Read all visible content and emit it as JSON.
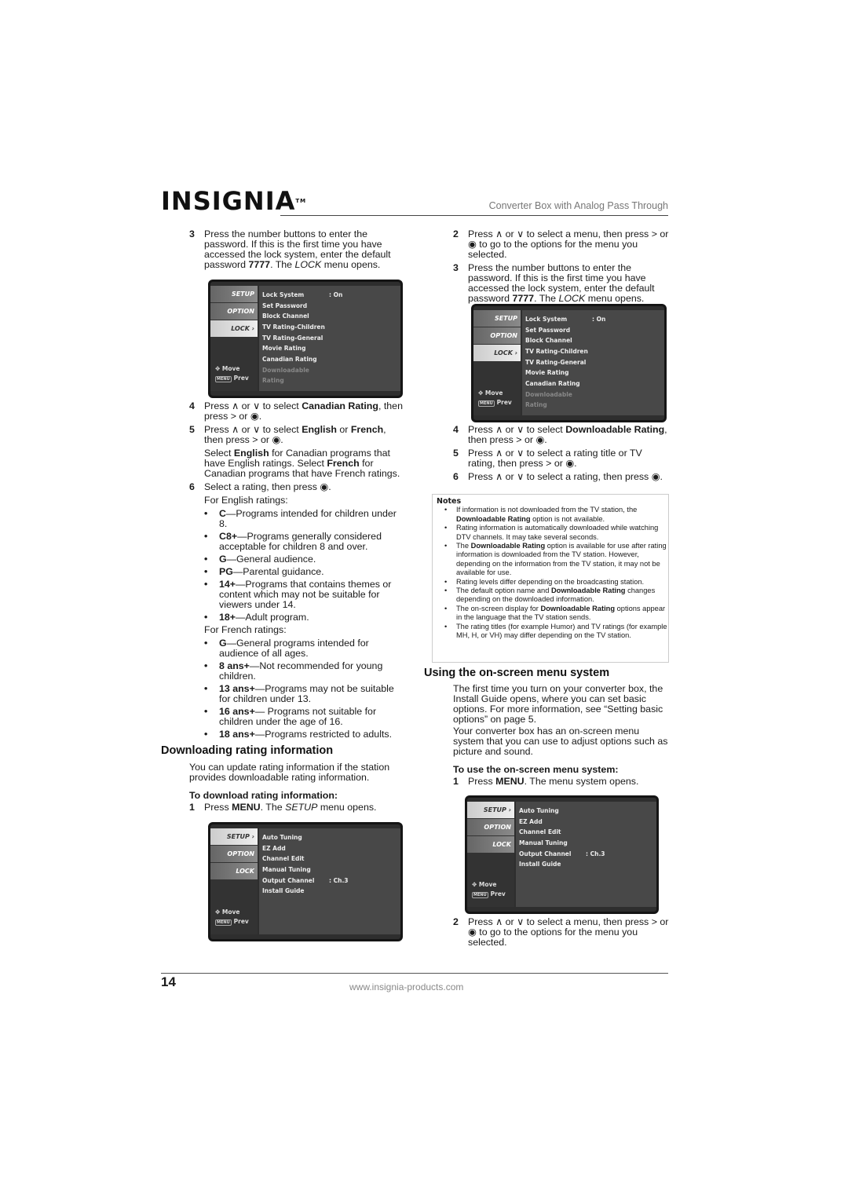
{
  "header": {
    "logo": "INSIGNIA",
    "tm": "TM",
    "title": "Converter Box with Analog Pass Through"
  },
  "left": {
    "step3": {
      "n": "3",
      "text": [
        [
          "Press the number buttons to enter the password. If this is the first time you have accessed the lock system, enter the default password ",
          ""
        ],
        [
          "7777",
          "b"
        ],
        [
          ". The ",
          ""
        ],
        [
          "LOCK",
          "i"
        ],
        [
          " menu opens.",
          ""
        ]
      ]
    },
    "step4": {
      "n": "4",
      "text": [
        [
          "Press ∧ or ∨ to select ",
          ""
        ],
        [
          "Canadian Rating",
          "b"
        ],
        [
          ", then press > or ◉.",
          ""
        ]
      ]
    },
    "step5": {
      "n": "5",
      "text": [
        [
          "Press ∧ or ∨ to select ",
          ""
        ],
        [
          "English",
          "b"
        ],
        [
          " or ",
          ""
        ],
        [
          "French",
          "b"
        ],
        [
          ", then press > or ◉.",
          ""
        ]
      ]
    },
    "step5_para": [
      [
        "Select ",
        ""
      ],
      [
        "English",
        "b"
      ],
      [
        " for Canadian programs that have English ratings. Select ",
        ""
      ],
      [
        "French",
        "b"
      ],
      [
        " for Canadian programs that have French ratings.",
        ""
      ]
    ],
    "step6": {
      "n": "6",
      "text": [
        [
          "Select a rating, then press ◉.",
          ""
        ]
      ]
    },
    "english_label": "For English ratings:",
    "english": [
      [
        [
          "C",
          "b"
        ],
        [
          "—Programs intended for children under 8.",
          ""
        ]
      ],
      [
        [
          "C8+",
          "b"
        ],
        [
          "—Programs generally considered acceptable for children 8 and over.",
          ""
        ]
      ],
      [
        [
          "G",
          "b"
        ],
        [
          "—General audience.",
          ""
        ]
      ],
      [
        [
          "PG",
          "b"
        ],
        [
          "—Parental guidance.",
          ""
        ]
      ],
      [
        [
          "14+",
          "b"
        ],
        [
          "—Programs that contains themes or content which may not be suitable for viewers under 14.",
          ""
        ]
      ],
      [
        [
          "18+",
          "b"
        ],
        [
          "—Adult program.",
          ""
        ]
      ]
    ],
    "french_label": "For French ratings:",
    "french": [
      [
        [
          "G",
          "b"
        ],
        [
          "—General programs intended for audience of all ages.",
          ""
        ]
      ],
      [
        [
          "8 ans+",
          "b"
        ],
        [
          "—Not recommended for young children.",
          ""
        ]
      ],
      [
        [
          "13 ans+",
          "b"
        ],
        [
          "—Programs may not be suitable for children under 13.",
          ""
        ]
      ],
      [
        [
          "16 ans+",
          "b"
        ],
        [
          "— Programs not suitable for children under the age of 16.",
          ""
        ]
      ],
      [
        [
          "18 ans+",
          "b"
        ],
        [
          "—Programs restricted to adults.",
          ""
        ]
      ]
    ],
    "heading": "Downloading rating information",
    "intro": "You can update rating information if the station provides downloadable rating information.",
    "subhead": "To download rating information:",
    "step1": {
      "n": "1",
      "text": [
        [
          "Press ",
          ""
        ],
        [
          "MENU",
          "b"
        ],
        [
          ". The ",
          ""
        ],
        [
          "SETUP",
          "i"
        ],
        [
          " menu opens.",
          ""
        ]
      ]
    }
  },
  "right": {
    "step2": {
      "n": "2",
      "text": [
        [
          "Press ∧ or ∨ to select a menu, then press > or ◉ to go to the options for the menu you selected.",
          ""
        ]
      ]
    },
    "step3": {
      "n": "3",
      "text": [
        [
          "Press the number buttons to enter the password. If this is the first time you have accessed the lock system, enter the default password ",
          ""
        ],
        [
          "7777",
          "b"
        ],
        [
          ". The ",
          ""
        ],
        [
          "LOCK",
          "i"
        ],
        [
          " menu opens.",
          ""
        ]
      ]
    },
    "step4": {
      "n": "4",
      "text": [
        [
          "Press ∧ or ∨ to select ",
          ""
        ],
        [
          "Downloadable Rating",
          "b"
        ],
        [
          ", then press > or ◉.",
          ""
        ]
      ]
    },
    "step5": {
      "n": "5",
      "text": [
        [
          "Press ∧ or ∨ to select a rating title or TV rating, then press > or ◉.",
          ""
        ]
      ]
    },
    "step6": {
      "n": "6",
      "text": [
        [
          "Press ∧ or ∨ to select a rating, then press ◉.",
          ""
        ]
      ]
    },
    "notes": {
      "title": "Notes",
      "items": [
        [
          [
            "If information is not downloaded from the TV station, the ",
            ""
          ],
          [
            "Downloadable Rating",
            "b"
          ],
          [
            " option is not available.",
            ""
          ]
        ],
        [
          [
            "Rating information is automatically downloaded while watching DTV channels. It may take several seconds.",
            ""
          ]
        ],
        [
          [
            "The ",
            ""
          ],
          [
            "Downloadable Rating",
            "b"
          ],
          [
            " option is available for use after rating information is downloaded from the TV station. However, depending on the information from the TV station, it may not be available for use.",
            ""
          ]
        ],
        [
          [
            "Rating levels differ depending on the broadcasting station.",
            ""
          ]
        ],
        [
          [
            "The default option name and ",
            ""
          ],
          [
            "Downloadable Rating",
            "b"
          ],
          [
            " changes depending on the downloaded information.",
            ""
          ]
        ],
        [
          [
            "The on-screen display for ",
            ""
          ],
          [
            "Downloadable Rating",
            "b"
          ],
          [
            " options appear in the language that the TV station sends.",
            ""
          ]
        ],
        [
          [
            "The rating titles (for example Humor) and TV ratings (for example MH, H, or VH) may differ depending on the TV station.",
            ""
          ]
        ]
      ]
    },
    "heading": "Using the on-screen menu system",
    "para1": "The first time you turn on your converter box, the Install Guide opens, where you can set basic options. For more information, see “Setting basic options” on page 5.",
    "para2": "Your converter box has an on-screen menu system that you can use to adjust options such as picture and sound.",
    "subhead": "To use the on-screen menu system:",
    "step1": {
      "n": "1",
      "text": [
        [
          "Press ",
          ""
        ],
        [
          "MENU",
          "b"
        ],
        [
          ". The menu system opens.",
          ""
        ]
      ]
    }
  },
  "menus": {
    "lock": {
      "tabs": [
        "SETUP",
        "OPTION",
        "LOCK ›"
      ],
      "active": 2,
      "items": [
        [
          "Lock System",
          ": On"
        ],
        [
          "Set Password",
          ""
        ],
        [
          "Block Channel",
          ""
        ],
        [
          "TV Rating-Children",
          ""
        ],
        [
          "TV Rating-General",
          ""
        ],
        [
          "Movie Rating",
          ""
        ],
        [
          "Canadian Rating",
          ""
        ],
        [
          "Downloadable Rating",
          "",
          "dis"
        ]
      ],
      "move": "Move",
      "prev": "Prev",
      "menu_key": "MENU"
    },
    "setup": {
      "tabs": [
        "SETUP ›",
        "OPTION",
        "LOCK"
      ],
      "active": 0,
      "items": [
        [
          "Auto Tuning",
          ""
        ],
        [
          "EZ Add",
          ""
        ],
        [
          "Channel Edit",
          ""
        ],
        [
          "Manual Tuning",
          ""
        ],
        [
          "Output Channel",
          ": Ch.3"
        ],
        [
          "Install Guide",
          ""
        ]
      ],
      "move": "Move",
      "prev": "Prev",
      "menu_key": "MENU"
    }
  },
  "footer": {
    "page": "14",
    "url": "www.insignia-products.com"
  }
}
